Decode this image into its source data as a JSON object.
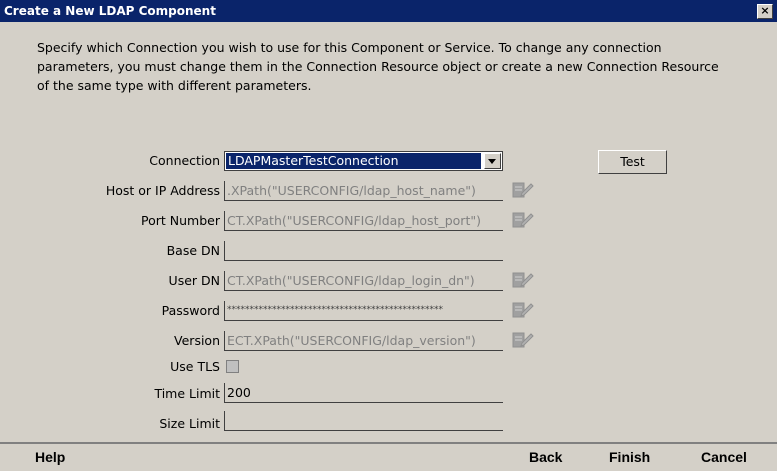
{
  "window": {
    "title": "Create a New LDAP Component",
    "close_label": "×"
  },
  "description": "Specify which Connection you wish to use for this Component or Service.  To change any connection parameters, you must change them in the Connection Resource object or create a new Connection Resource of the same type with different parameters.",
  "connection": {
    "label": "Connection",
    "value": "LDAPMasterTestConnection"
  },
  "test_button": "Test",
  "fields": {
    "host": {
      "label": "Host or IP Address",
      "value": ".XPath(\"USERCONFIG/ldap_host_name\")"
    },
    "port": {
      "label": "Port Number",
      "value": "CT.XPath(\"USERCONFIG/ldap_host_port\")"
    },
    "base_dn": {
      "label": "Base DN",
      "value": ""
    },
    "user_dn": {
      "label": "User DN",
      "value": "CT.XPath(\"USERCONFIG/ldap_login_dn\")"
    },
    "password": {
      "label": "Password",
      "value": "************************************************"
    },
    "version": {
      "label": "Version",
      "value": "ECT.XPath(\"USERCONFIG/ldap_version\")"
    },
    "use_tls": {
      "label": "Use TLS"
    },
    "time_limit": {
      "label": "Time Limit",
      "value": "200"
    },
    "size_limit": {
      "label": "Size Limit",
      "value": ""
    }
  },
  "footer": {
    "help": "Help",
    "back": "Back",
    "finish": "Finish",
    "cancel": "Cancel"
  },
  "colors": {
    "titlebar": "#0a246a",
    "dialog": "#d4d0c8",
    "selection": "#0a246a"
  }
}
